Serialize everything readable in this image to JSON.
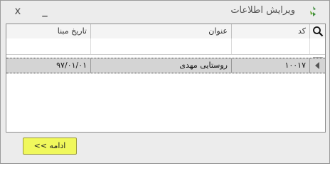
{
  "window": {
    "title": "ویرایش اطلاعات",
    "close_glyph": "x",
    "minimize_glyph": "_"
  },
  "grid": {
    "columns": [
      {
        "key": "code",
        "label": "کد"
      },
      {
        "key": "title",
        "label": "عنوان"
      },
      {
        "key": "start_date",
        "label": "تاریخ مبنا"
      }
    ],
    "rows": [
      {
        "code": "۱۰۰۱۷",
        "title": "روستایی مهدی",
        "start_date": "۹۷/۰۱/۰۱"
      }
    ]
  },
  "footer": {
    "continue_label": "ادامه >>"
  },
  "colors": {
    "continue_button": "#f0f85c",
    "selected_row": "#d4d4d4",
    "app_icon": "#3c8c3c"
  }
}
